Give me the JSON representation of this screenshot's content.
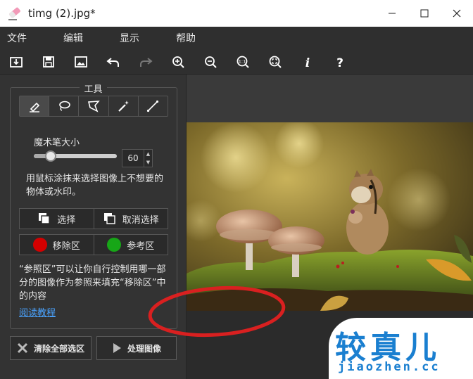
{
  "window": {
    "title": "timg (2).jpg*",
    "minimize_glyph": "—",
    "maximize_glyph": "☐",
    "close_glyph": "✕"
  },
  "menu": {
    "items": [
      "文件",
      "编辑",
      "显示",
      "帮助"
    ]
  },
  "toolbar": {
    "icons": [
      "open-icon",
      "save-icon",
      "image-icon",
      "undo-icon",
      "redo-icon",
      "zoom-in-icon",
      "zoom-out-icon",
      "actual-size-icon",
      "fit-screen-icon",
      "info-icon",
      "help-icon"
    ]
  },
  "tools": {
    "title": "工具",
    "items": [
      "brush-icon",
      "lasso-icon",
      "polygon-lasso-icon",
      "magic-wand-icon",
      "line-icon"
    ],
    "active_index": 0
  },
  "brush": {
    "label": "魔术笔大小",
    "value": "60",
    "slider_fraction": 0.2
  },
  "help_text": "用鼠标涂抹来选择图像上不想要的物体或水印。",
  "selection": {
    "select_label": "选择",
    "deselect_label": "取消选择"
  },
  "areas": {
    "remove_label": "移除区",
    "remove_color": "#d40000",
    "reference_label": "参考区",
    "reference_color": "#17a617"
  },
  "info_text": "“参照区”可以让你自行控制用哪一部分的图像作为参照来填充“移除区”中的内容",
  "tutorial_link": "阅读教程",
  "actions": {
    "clear_label": "清除全部选区",
    "process_label": "处理图像"
  },
  "watermark": {
    "big": "较真儿",
    "small": "jiaozhen.cc"
  },
  "colors": {
    "accent_link": "#4aa3ff",
    "annotation_red": "#d92020"
  }
}
